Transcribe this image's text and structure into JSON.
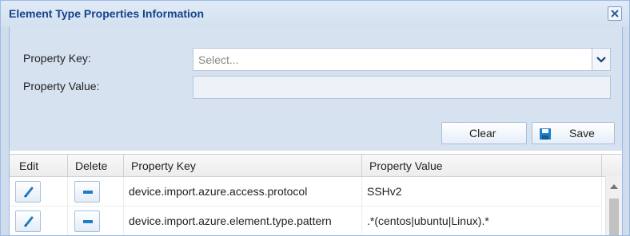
{
  "dialog": {
    "title": "Element Type Properties Information",
    "close_icon": "close-icon"
  },
  "form": {
    "property_key_label": "Property Key:",
    "property_key_placeholder": "Select...",
    "property_key_value": "",
    "property_value_label": "Property Value:",
    "property_value_value": "",
    "dropdown_icon": "chevron-down-icon"
  },
  "buttons": {
    "clear_label": "Clear",
    "save_label": "Save",
    "save_icon": "floppy-disk-icon"
  },
  "grid": {
    "columns": [
      "Edit",
      "Delete",
      "Property Key",
      "Property Value"
    ],
    "rows": [
      {
        "property_key": "device.import.azure.access.protocol",
        "property_value": "SSHv2"
      },
      {
        "property_key": "device.import.azure.element.type.pattern",
        "property_value": ".*(centos|ubuntu|Linux).*"
      }
    ],
    "edit_icon": "pencil-icon",
    "delete_icon": "minus-icon"
  },
  "colors": {
    "title_text": "#15428b",
    "panel_background": "#d6e2f0",
    "border": "#99bbe8",
    "icon_accent": "#1e7dc8"
  }
}
